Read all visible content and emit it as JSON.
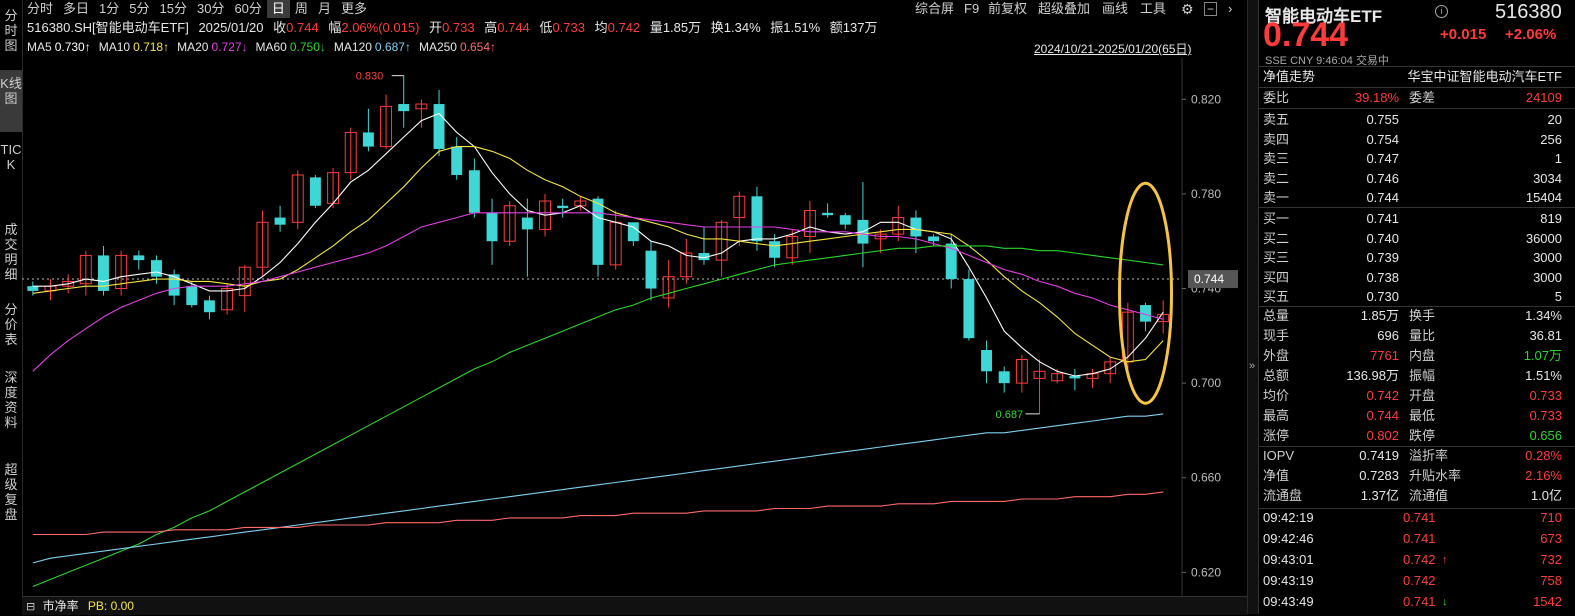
{
  "left_nav": [
    "分时图",
    "K线图",
    "TICK",
    "成交明细",
    "分价表",
    "深度资料",
    "超级复盘"
  ],
  "toolbar": {
    "periods": [
      "分时",
      "多日",
      "1分",
      "5分",
      "15分",
      "30分",
      "60分",
      "日",
      "周",
      "月",
      "更多"
    ],
    "active_period": "日",
    "right_items": [
      "综合屏",
      "F9",
      "前复权",
      "超级叠加",
      "画线",
      "工具"
    ]
  },
  "info": {
    "code_name": "516380.SH[智能电动车ETF]",
    "date": "2025/01/20",
    "close_label": "收",
    "close": "0.744",
    "change_label": "幅",
    "change": "2.06%(0.015)",
    "open_label": "开",
    "open": "0.733",
    "high_label": "高",
    "high": "0.744",
    "low_label": "低",
    "low": "0.733",
    "avg_label": "均",
    "avg": "0.742",
    "vol_label": "量",
    "vol": "1.85万",
    "turnover_label": "换",
    "turnover": "1.34%",
    "amp_label": "振",
    "amp": "1.51%",
    "amount_label": "额",
    "amount": "137万"
  },
  "ma": [
    {
      "label": "MA5",
      "value": "0.730↑",
      "color": "#ffffff"
    },
    {
      "label": "MA10",
      "value": "0.718↑",
      "color": "#f5e642"
    },
    {
      "label": "MA20",
      "value": "0.727↓",
      "color": "#e040e0"
    },
    {
      "label": "MA60",
      "value": "0.750↓",
      "color": "#2bd52b"
    },
    {
      "label": "MA120",
      "value": "0.687↑",
      "color": "#7fd0f0"
    },
    {
      "label": "MA250",
      "value": "0.654↑",
      "color": "#ff6a6a"
    }
  ],
  "range_label": "2024/10/21-2025/01/20(65日)",
  "chart_data": {
    "type": "candlestick",
    "y_ticks": [
      0.82,
      0.78,
      0.74,
      0.7,
      0.66,
      0.62
    ],
    "ylim": [
      0.61,
      0.84
    ],
    "current_price": "0.744",
    "max_label": "0.830",
    "min_label": "0.687",
    "candles": [
      [
        0.741,
        0.743,
        0.737,
        0.739
      ],
      [
        0.739,
        0.744,
        0.735,
        0.741
      ],
      [
        0.741,
        0.746,
        0.738,
        0.743
      ],
      [
        0.742,
        0.756,
        0.737,
        0.754
      ],
      [
        0.754,
        0.758,
        0.737,
        0.739
      ],
      [
        0.74,
        0.756,
        0.737,
        0.754
      ],
      [
        0.754,
        0.756,
        0.748,
        0.752
      ],
      [
        0.752,
        0.754,
        0.742,
        0.745
      ],
      [
        0.746,
        0.748,
        0.733,
        0.737
      ],
      [
        0.741,
        0.743,
        0.732,
        0.733
      ],
      [
        0.735,
        0.737,
        0.727,
        0.73
      ],
      [
        0.731,
        0.742,
        0.729,
        0.74
      ],
      [
        0.737,
        0.75,
        0.73,
        0.749
      ],
      [
        0.749,
        0.773,
        0.745,
        0.768
      ],
      [
        0.77,
        0.775,
        0.764,
        0.767
      ],
      [
        0.768,
        0.79,
        0.765,
        0.788
      ],
      [
        0.787,
        0.788,
        0.774,
        0.775
      ],
      [
        0.776,
        0.791,
        0.774,
        0.789
      ],
      [
        0.789,
        0.808,
        0.786,
        0.806
      ],
      [
        0.806,
        0.816,
        0.798,
        0.8
      ],
      [
        0.8,
        0.822,
        0.799,
        0.817
      ],
      [
        0.818,
        0.83,
        0.808,
        0.815
      ],
      [
        0.816,
        0.82,
        0.808,
        0.818
      ],
      [
        0.818,
        0.824,
        0.796,
        0.799
      ],
      [
        0.8,
        0.804,
        0.786,
        0.788
      ],
      [
        0.79,
        0.795,
        0.77,
        0.772
      ],
      [
        0.772,
        0.778,
        0.75,
        0.76
      ],
      [
        0.76,
        0.777,
        0.758,
        0.775
      ],
      [
        0.77,
        0.778,
        0.745,
        0.765
      ],
      [
        0.765,
        0.78,
        0.762,
        0.777
      ],
      [
        0.775,
        0.778,
        0.77,
        0.774
      ],
      [
        0.775,
        0.779,
        0.773,
        0.777
      ],
      [
        0.778,
        0.779,
        0.745,
        0.75
      ],
      [
        0.75,
        0.773,
        0.748,
        0.768
      ],
      [
        0.768,
        0.767,
        0.758,
        0.76
      ],
      [
        0.756,
        0.76,
        0.735,
        0.74
      ],
      [
        0.736,
        0.752,
        0.732,
        0.745
      ],
      [
        0.745,
        0.761,
        0.742,
        0.755
      ],
      [
        0.755,
        0.766,
        0.75,
        0.752
      ],
      [
        0.752,
        0.769,
        0.745,
        0.768
      ],
      [
        0.77,
        0.781,
        0.758,
        0.779
      ],
      [
        0.779,
        0.783,
        0.756,
        0.76
      ],
      [
        0.76,
        0.763,
        0.749,
        0.753
      ],
      [
        0.753,
        0.765,
        0.75,
        0.762
      ],
      [
        0.762,
        0.777,
        0.755,
        0.773
      ],
      [
        0.772,
        0.776,
        0.77,
        0.771
      ],
      [
        0.771,
        0.772,
        0.765,
        0.767
      ],
      [
        0.769,
        0.785,
        0.749,
        0.759
      ],
      [
        0.761,
        0.765,
        0.755,
        0.763
      ],
      [
        0.763,
        0.775,
        0.76,
        0.77
      ],
      [
        0.77,
        0.773,
        0.755,
        0.762
      ],
      [
        0.762,
        0.763,
        0.758,
        0.76
      ],
      [
        0.759,
        0.763,
        0.74,
        0.744
      ],
      [
        0.744,
        0.748,
        0.718,
        0.719
      ],
      [
        0.714,
        0.718,
        0.7,
        0.705
      ],
      [
        0.705,
        0.707,
        0.696,
        0.7
      ],
      [
        0.7,
        0.712,
        0.696,
        0.71
      ],
      [
        0.702,
        0.71,
        0.687,
        0.705
      ],
      [
        0.701,
        0.706,
        0.7,
        0.704
      ],
      [
        0.703,
        0.706,
        0.697,
        0.702
      ],
      [
        0.702,
        0.706,
        0.698,
        0.704
      ],
      [
        0.704,
        0.711,
        0.7,
        0.709
      ],
      [
        0.709,
        0.734,
        0.702,
        0.73
      ],
      [
        0.733,
        0.734,
        0.722,
        0.726
      ],
      [
        0.726,
        0.735,
        0.721,
        0.729
      ]
    ],
    "ma_lines": {
      "MA5": [
        0.741,
        0.741,
        0.742,
        0.744,
        0.743,
        0.745,
        0.746,
        0.747,
        0.745,
        0.742,
        0.739,
        0.739,
        0.74,
        0.745,
        0.751,
        0.759,
        0.768,
        0.776,
        0.785,
        0.79,
        0.797,
        0.804,
        0.811,
        0.814,
        0.806,
        0.8,
        0.789,
        0.78,
        0.773,
        0.771,
        0.772,
        0.775,
        0.77,
        0.768,
        0.766,
        0.76,
        0.758,
        0.754,
        0.753,
        0.755,
        0.76,
        0.761,
        0.761,
        0.763,
        0.766,
        0.764,
        0.763,
        0.764,
        0.768,
        0.768,
        0.765,
        0.764,
        0.761,
        0.749,
        0.736,
        0.722,
        0.715,
        0.709,
        0.705,
        0.703,
        0.704,
        0.706,
        0.711,
        0.719,
        0.73
      ],
      "MA10": [
        0.738,
        0.739,
        0.74,
        0.741,
        0.741,
        0.742,
        0.743,
        0.744,
        0.744,
        0.743,
        0.743,
        0.742,
        0.741,
        0.743,
        0.744,
        0.748,
        0.753,
        0.758,
        0.764,
        0.769,
        0.776,
        0.783,
        0.791,
        0.798,
        0.8,
        0.8,
        0.798,
        0.795,
        0.79,
        0.786,
        0.783,
        0.779,
        0.776,
        0.772,
        0.77,
        0.768,
        0.766,
        0.763,
        0.761,
        0.761,
        0.76,
        0.759,
        0.758,
        0.759,
        0.76,
        0.761,
        0.762,
        0.763,
        0.764,
        0.765,
        0.765,
        0.764,
        0.763,
        0.758,
        0.752,
        0.745,
        0.739,
        0.734,
        0.728,
        0.721,
        0.716,
        0.711,
        0.709,
        0.71,
        0.718
      ],
      "MA20": [
        0.705,
        0.712,
        0.718,
        0.723,
        0.728,
        0.732,
        0.735,
        0.738,
        0.74,
        0.741,
        0.741,
        0.741,
        0.742,
        0.743,
        0.745,
        0.747,
        0.749,
        0.751,
        0.753,
        0.755,
        0.758,
        0.762,
        0.766,
        0.768,
        0.77,
        0.772,
        0.772,
        0.772,
        0.772,
        0.772,
        0.772,
        0.772,
        0.772,
        0.771,
        0.77,
        0.769,
        0.768,
        0.767,
        0.766,
        0.766,
        0.766,
        0.766,
        0.766,
        0.765,
        0.764,
        0.764,
        0.764,
        0.763,
        0.762,
        0.762,
        0.761,
        0.759,
        0.757,
        0.754,
        0.751,
        0.748,
        0.746,
        0.743,
        0.741,
        0.738,
        0.736,
        0.733,
        0.731,
        0.729,
        0.727
      ],
      "MA60": [
        0.614,
        0.617,
        0.62,
        0.623,
        0.626,
        0.629,
        0.632,
        0.636,
        0.639,
        0.643,
        0.646,
        0.65,
        0.654,
        0.658,
        0.662,
        0.666,
        0.67,
        0.674,
        0.678,
        0.682,
        0.686,
        0.69,
        0.694,
        0.698,
        0.702,
        0.706,
        0.709,
        0.713,
        0.716,
        0.719,
        0.722,
        0.725,
        0.728,
        0.731,
        0.733,
        0.736,
        0.738,
        0.74,
        0.742,
        0.744,
        0.746,
        0.748,
        0.75,
        0.751,
        0.752,
        0.753,
        0.754,
        0.755,
        0.756,
        0.757,
        0.757,
        0.758,
        0.758,
        0.758,
        0.758,
        0.757,
        0.757,
        0.756,
        0.756,
        0.755,
        0.754,
        0.753,
        0.752,
        0.751,
        0.75
      ],
      "MA120": [
        0.624,
        0.626,
        0.627,
        0.628,
        0.629,
        0.63,
        0.631,
        0.632,
        0.633,
        0.634,
        0.635,
        0.636,
        0.637,
        0.638,
        0.639,
        0.64,
        0.641,
        0.642,
        0.643,
        0.644,
        0.645,
        0.646,
        0.647,
        0.648,
        0.649,
        0.65,
        0.651,
        0.652,
        0.653,
        0.654,
        0.655,
        0.656,
        0.657,
        0.658,
        0.659,
        0.66,
        0.661,
        0.662,
        0.663,
        0.664,
        0.665,
        0.666,
        0.667,
        0.668,
        0.669,
        0.67,
        0.671,
        0.672,
        0.673,
        0.674,
        0.675,
        0.676,
        0.677,
        0.678,
        0.679,
        0.679,
        0.68,
        0.681,
        0.682,
        0.683,
        0.684,
        0.685,
        0.686,
        0.686,
        0.687
      ],
      "MA250": [
        0.636,
        0.636,
        0.636,
        0.636,
        0.637,
        0.637,
        0.637,
        0.637,
        0.638,
        0.638,
        0.638,
        0.638,
        0.639,
        0.639,
        0.639,
        0.639,
        0.64,
        0.64,
        0.64,
        0.64,
        0.641,
        0.641,
        0.641,
        0.641,
        0.642,
        0.642,
        0.642,
        0.643,
        0.643,
        0.643,
        0.643,
        0.644,
        0.644,
        0.644,
        0.645,
        0.645,
        0.645,
        0.645,
        0.646,
        0.646,
        0.646,
        0.646,
        0.647,
        0.647,
        0.647,
        0.648,
        0.648,
        0.648,
        0.648,
        0.649,
        0.649,
        0.649,
        0.65,
        0.65,
        0.65,
        0.65,
        0.651,
        0.651,
        0.651,
        0.652,
        0.652,
        0.652,
        0.653,
        0.653,
        0.654
      ]
    }
  },
  "bottom": {
    "label1": "市净率",
    "label2": "PB: 0.00"
  },
  "quote": {
    "name": "智能电动车ETF",
    "code": "516380",
    "price": "0.744",
    "chg": "+0.015",
    "pct": "+2.06%",
    "meta1": "SSE",
    "meta2": "CNY",
    "meta3": "9:46:04",
    "meta4": "交易中",
    "nav_trend": "净值走势",
    "fund_name": "华宝中证智能电动汽车ETF",
    "weibi_label": "委比",
    "weibi": "39.18%",
    "weicha_label": "委差",
    "weicha": "24109"
  },
  "asks": [
    {
      "label": "卖五",
      "price": "0.755",
      "vol": "20"
    },
    {
      "label": "卖四",
      "price": "0.754",
      "vol": "256"
    },
    {
      "label": "卖三",
      "price": "0.747",
      "vol": "1"
    },
    {
      "label": "卖二",
      "price": "0.746",
      "vol": "3034"
    },
    {
      "label": "卖一",
      "price": "0.744",
      "vol": "15404"
    }
  ],
  "bids": [
    {
      "label": "买一",
      "price": "0.741",
      "vol": "819"
    },
    {
      "label": "买二",
      "price": "0.740",
      "vol": "36000"
    },
    {
      "label": "买三",
      "price": "0.739",
      "vol": "3000"
    },
    {
      "label": "买四",
      "price": "0.738",
      "vol": "3000"
    },
    {
      "label": "买五",
      "price": "0.730",
      "vol": "5"
    }
  ],
  "stats": [
    {
      "l1": "总量",
      "v1": "1.85万",
      "c1": "white",
      "l2": "换手",
      "v2": "1.34%",
      "c2": "white"
    },
    {
      "l1": "现手",
      "v1": "696",
      "c1": "white",
      "l2": "量比",
      "v2": "36.81",
      "c2": "white"
    },
    {
      "l1": "外盘",
      "v1": "7761",
      "c1": "red",
      "l2": "内盘",
      "v2": "1.07万",
      "c2": "green"
    },
    {
      "l1": "总额",
      "v1": "136.98万",
      "c1": "white",
      "l2": "振幅",
      "v2": "1.51%",
      "c2": "white"
    },
    {
      "l1": "均价",
      "v1": "0.742",
      "c1": "red",
      "l2": "开盘",
      "v2": "0.733",
      "c2": "red"
    },
    {
      "l1": "最高",
      "v1": "0.744",
      "c1": "red",
      "l2": "最低",
      "v2": "0.733",
      "c2": "red"
    },
    {
      "l1": "涨停",
      "v1": "0.802",
      "c1": "red",
      "l2": "跌停",
      "v2": "0.656",
      "c2": "green"
    }
  ],
  "fund_stats": [
    {
      "l1": "IOPV",
      "v1": "0.7419",
      "c1": "white",
      "l2": "溢折率",
      "v2": "0.28%",
      "c2": "red"
    },
    {
      "l1": "净值",
      "v1": "0.7283",
      "c1": "white",
      "l2": "升贴水率",
      "v2": "2.16%",
      "c2": "red"
    },
    {
      "l1": "流通盘",
      "v1": "1.37亿",
      "c1": "white",
      "l2": "流通值",
      "v2": "1.0亿",
      "c2": "white"
    }
  ],
  "ticks": [
    {
      "time": "09:42:19",
      "price": "0.741",
      "arrow": "",
      "vol": "710"
    },
    {
      "time": "09:42:46",
      "price": "0.741",
      "arrow": "",
      "vol": "673"
    },
    {
      "time": "09:43:01",
      "price": "0.742",
      "arrow": "↑",
      "vol": "732"
    },
    {
      "time": "09:43:19",
      "price": "0.742",
      "arrow": "",
      "vol": "758"
    },
    {
      "time": "09:43:49",
      "price": "0.741",
      "arrow": "↓",
      "vol": "1542"
    }
  ]
}
